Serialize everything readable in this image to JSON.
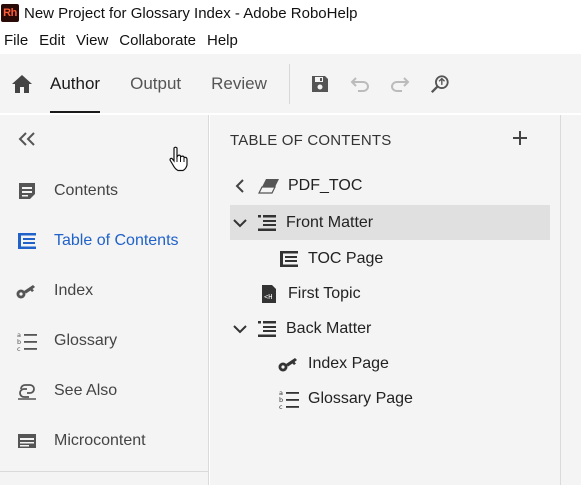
{
  "window": {
    "app_icon_text": "Rh",
    "title": "New Project for Glossary Index - Adobe RoboHelp"
  },
  "menu": [
    "File",
    "Edit",
    "View",
    "Collaborate",
    "Help"
  ],
  "toolbar": {
    "tabs": [
      "Author",
      "Output",
      "Review"
    ],
    "active_tab": "Author",
    "icons": [
      "home-icon",
      "save-icon",
      "undo-icon",
      "redo-icon",
      "search-replace-icon"
    ]
  },
  "left_panel": {
    "items": [
      {
        "label": "Contents",
        "icon": "contents-icon"
      },
      {
        "label": "Table of Contents",
        "icon": "toc-icon",
        "active": true
      },
      {
        "label": "Index",
        "icon": "key-icon"
      },
      {
        "label": "Glossary",
        "icon": "glossary-icon"
      },
      {
        "label": "See Also",
        "icon": "see-also-icon"
      },
      {
        "label": "Microcontent",
        "icon": "microcontent-icon"
      }
    ]
  },
  "toc_panel": {
    "header": "TABLE OF CONTENTS",
    "tree": [
      {
        "label": "PDF_TOC",
        "icon": "eraser-icon",
        "chevron": "left"
      },
      {
        "label": "Front Matter",
        "icon": "book-icon",
        "chevron": "down",
        "selected": true
      },
      {
        "label": "TOC Page",
        "icon": "toc-icon"
      },
      {
        "label": "First Topic",
        "icon": "topic-file-icon"
      },
      {
        "label": "Back Matter",
        "icon": "book-icon",
        "chevron": "down"
      },
      {
        "label": "Index Page",
        "icon": "key-icon"
      },
      {
        "label": "Glossary Page",
        "icon": "glossary-icon"
      }
    ]
  },
  "colors": {
    "accent": "#2062c9",
    "panel_bg": "#f4f4f4",
    "selected_bg": "#e0e0e0"
  }
}
